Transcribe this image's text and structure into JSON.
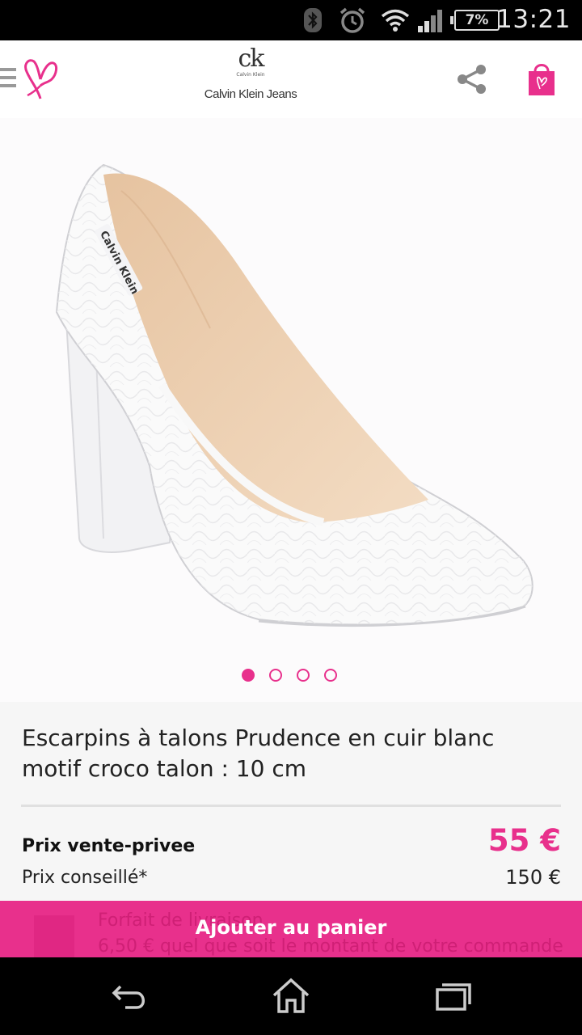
{
  "status_bar": {
    "time": "13:21",
    "battery": "7%",
    "icons": [
      "bluetooth-icon",
      "alarm-icon",
      "wifi-icon",
      "signal-icon",
      "battery-icon"
    ]
  },
  "header": {
    "brand_mark": "ck",
    "brand_mark_sub": "Calvin Klein",
    "brand_name": "Calvin Klein Jeans",
    "icons": [
      "menu-icon",
      "butterfly-logo-icon",
      "share-icon",
      "shopping-bag-icon"
    ]
  },
  "product": {
    "image_brand_label": "Calvin Klein",
    "pager_pages": 4,
    "pager_active": 1,
    "title": "Escarpins à talons Prudence en cuir blanc motif croco talon : 10 cm",
    "price_label": "Prix vente-privee",
    "price_value": "55 €",
    "msrp_label": "Prix conseillé*",
    "msrp_value": "150 €"
  },
  "cart_bar": {
    "add_label": "Ajouter au panier",
    "shipping_title": "Forfait de livraison",
    "shipping_text": "6,50 € quel que soit le montant de votre commande"
  },
  "nav": {
    "icons": [
      "back-icon",
      "home-icon",
      "recent-apps-icon"
    ]
  },
  "colors": {
    "accent": "#e8308c",
    "text": "#222222",
    "panel": "#f6f6f6"
  }
}
